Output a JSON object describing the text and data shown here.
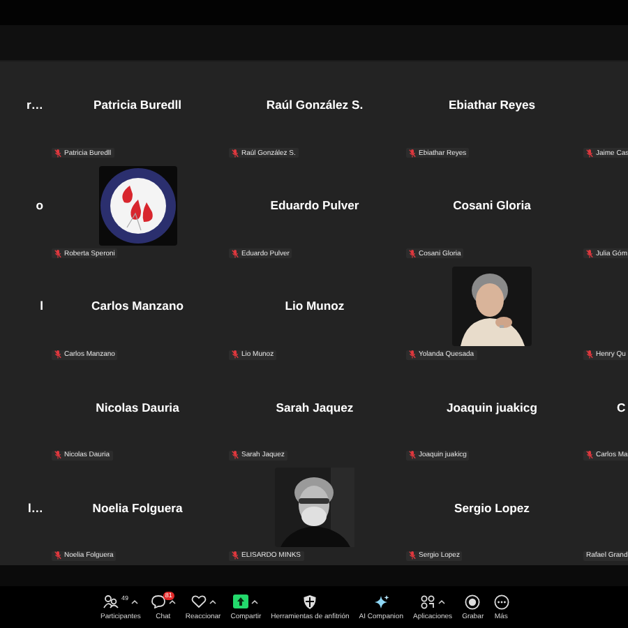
{
  "gallery": {
    "rows": [
      {
        "tiles": [
          {
            "kind": "name",
            "name": "r…"
          },
          {
            "kind": "name",
            "name": "Patricia Buredll",
            "label": "Patricia Buredll",
            "muted": true
          },
          {
            "kind": "name",
            "name": "Raúl González S.",
            "label": "Raúl González S.",
            "muted": true
          },
          {
            "kind": "name",
            "name": "Ebiathar Reyes",
            "label": "Ebiathar Reyes",
            "muted": true
          },
          {
            "kind": "name",
            "label": "Jaime Cas",
            "muted": true
          }
        ]
      },
      {
        "tiles": [
          {
            "kind": "name",
            "name": "o"
          },
          {
            "kind": "picture",
            "label": "Roberta Speroni",
            "muted": true
          },
          {
            "kind": "name",
            "name": "Eduardo Pulver",
            "label": "Eduardo Pulver",
            "muted": true
          },
          {
            "kind": "name",
            "name": "Cosani Gloria",
            "label": "Cosani Gloria",
            "muted": true
          },
          {
            "kind": "name",
            "label": "Julia Góm",
            "muted": true
          }
        ]
      },
      {
        "tiles": [
          {
            "kind": "name",
            "name": "l"
          },
          {
            "kind": "name",
            "name": "Carlos Manzano",
            "label": "Carlos Manzano",
            "muted": true
          },
          {
            "kind": "name",
            "name": "Lio Munoz",
            "label": "Lio Munoz",
            "muted": true
          },
          {
            "kind": "picture",
            "label": "Yolanda Quesada",
            "muted": true
          },
          {
            "kind": "name",
            "label": "Henry Qu",
            "muted": true
          }
        ]
      },
      {
        "tiles": [
          {
            "kind": "name"
          },
          {
            "kind": "name",
            "name": "Nicolas Dauria",
            "label": "Nicolas Dauria",
            "muted": true
          },
          {
            "kind": "name",
            "name": "Sarah Jaquez",
            "label": "Sarah Jaquez",
            "muted": true
          },
          {
            "kind": "name",
            "name": "Joaquin juakicg",
            "label": "Joaquin juakicg",
            "muted": true
          },
          {
            "kind": "name",
            "name": "C",
            "label": "Carlos Ma",
            "muted": true
          }
        ]
      },
      {
        "tiles": [
          {
            "kind": "name",
            "name": "l…"
          },
          {
            "kind": "name",
            "name": "Noelia Folguera",
            "label": "Noelia Folguera",
            "muted": true
          },
          {
            "kind": "picture",
            "label": "ELISARDO MINKS",
            "muted": true
          },
          {
            "kind": "name",
            "name": "Sergio Lopez",
            "label": "Sergio Lopez",
            "muted": true
          },
          {
            "kind": "name",
            "label": "Rafael Grand",
            "muted": false
          }
        ]
      }
    ]
  },
  "toolbar": [
    {
      "kind": "participants",
      "label": "Participantes",
      "count": "49",
      "caret": true
    },
    {
      "kind": "chat",
      "label": "Chat",
      "badge": "81",
      "caret": true
    },
    {
      "kind": "react",
      "label": "Reaccionar",
      "caret": true
    },
    {
      "kind": "share",
      "label": "Compartir",
      "caret": true
    },
    {
      "kind": "host",
      "label": "Herramientas de anfitrión",
      "caret": false
    },
    {
      "kind": "ai",
      "label": "AI Companion",
      "caret": false
    },
    {
      "kind": "apps",
      "label": "Aplicaciones",
      "caret": true
    },
    {
      "kind": "record",
      "label": "Grabar",
      "caret": false
    },
    {
      "kind": "more",
      "label": "Más",
      "caret": false
    }
  ]
}
